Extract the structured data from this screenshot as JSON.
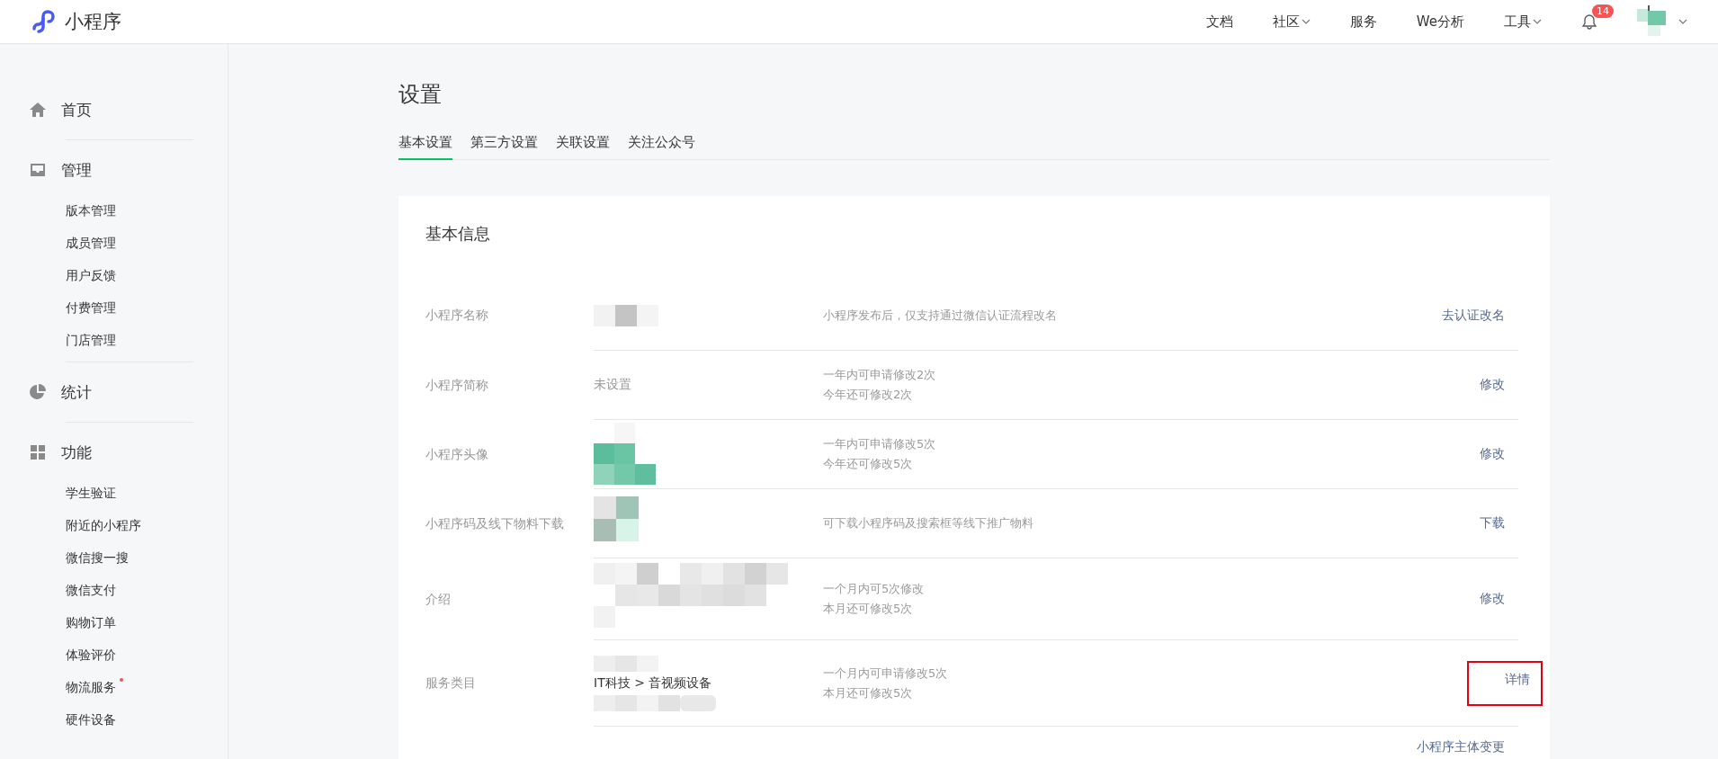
{
  "header": {
    "brand": "小程序",
    "nav": [
      {
        "label": "文档",
        "dropdown": false
      },
      {
        "label": "社区",
        "dropdown": true
      },
      {
        "label": "服务",
        "dropdown": false
      },
      {
        "label": "We分析",
        "dropdown": false
      },
      {
        "label": "工具",
        "dropdown": true
      }
    ],
    "notification_count": "14"
  },
  "sidebar": {
    "sections": [
      {
        "label": "首页"
      },
      {
        "label": "管理",
        "items": [
          {
            "label": "版本管理",
            "dot": false
          },
          {
            "label": "成员管理",
            "dot": false
          },
          {
            "label": "用户反馈",
            "dot": false
          },
          {
            "label": "付费管理",
            "dot": false
          },
          {
            "label": "门店管理",
            "dot": false
          }
        ]
      },
      {
        "label": "统计"
      },
      {
        "label": "功能",
        "items": [
          {
            "label": "学生验证",
            "dot": false
          },
          {
            "label": "附近的小程序",
            "dot": false
          },
          {
            "label": "微信搜一搜",
            "dot": false
          },
          {
            "label": "微信支付",
            "dot": false
          },
          {
            "label": "购物订单",
            "dot": false
          },
          {
            "label": "体验评价",
            "dot": false
          },
          {
            "label": "物流服务",
            "dot": true
          },
          {
            "label": "硬件设备",
            "dot": false
          }
        ]
      }
    ]
  },
  "page": {
    "title": "设置",
    "tabs": [
      {
        "label": "基本设置",
        "selected": true
      },
      {
        "label": "第三方设置",
        "selected": false
      },
      {
        "label": "关联设置",
        "selected": false
      },
      {
        "label": "关注公众号",
        "selected": false
      }
    ]
  },
  "card": {
    "title": "基本信息",
    "rows": [
      {
        "label": "小程序名称",
        "value": {
          "kind": "picture"
        },
        "notes": [
          "小程序发布后，仅支持通过微信认证流程改名"
        ],
        "action": "去认证改名",
        "highlighted": false
      },
      {
        "label": "小程序简称",
        "value": {
          "kind": "text",
          "text": "未设置"
        },
        "notes": [
          "一年内可申请修改2次",
          "今年还可修改2次"
        ],
        "action": "修改",
        "highlighted": false
      },
      {
        "label": "小程序头像",
        "value": {
          "kind": "picture"
        },
        "notes": [
          "一年内可申请修改5次",
          "今年还可修改5次"
        ],
        "action": "修改",
        "highlighted": false
      },
      {
        "label": "小程序码及线下物料下载",
        "value": {
          "kind": "picture"
        },
        "notes": [
          "可下载小程序码及搜索框等线下推广物料"
        ],
        "action": "下载",
        "highlighted": false
      },
      {
        "label": "介绍",
        "value": {
          "kind": "picture"
        },
        "notes": [
          "一个月内可5次修改",
          "本月还可修改5次"
        ],
        "action": "修改",
        "highlighted": false
      },
      {
        "label": "服务类目",
        "value": {
          "kind": "category",
          "text": "IT科技 > 音视频设备"
        },
        "notes": [
          "一个月内可申请修改5次",
          "本月还可修改5次"
        ],
        "action": "详情",
        "highlighted": true
      }
    ],
    "footer_link": "小程序主体变更"
  }
}
